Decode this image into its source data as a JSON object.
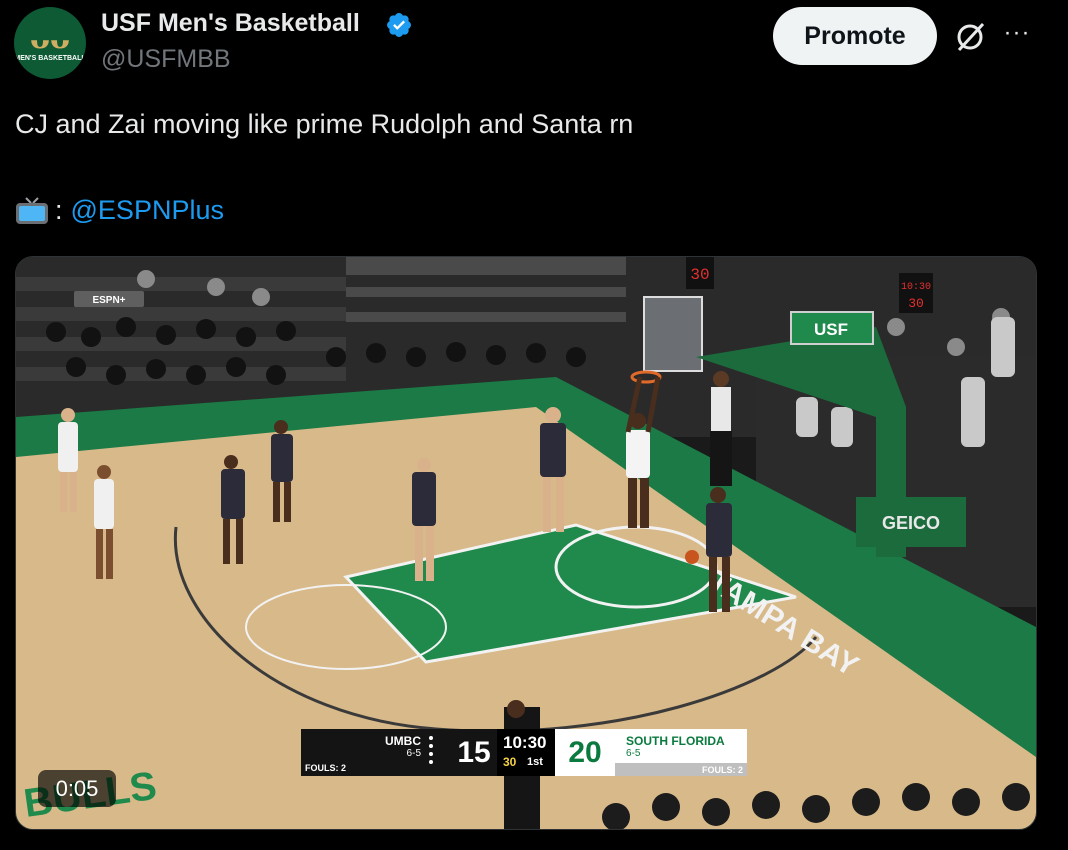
{
  "author": {
    "name": "USF Men's Basketball",
    "handle": "@USFMBB",
    "avatar_text": "MEN'S BASKETBALL",
    "verified_icon": "verified-badge-icon"
  },
  "actions": {
    "promote_label": "Promote",
    "grok_icon": "grok-icon",
    "more_label": "···"
  },
  "tweet": {
    "text": "CJ and Zai moving like prime Rudolph and Santa rn",
    "tv_icon": "television-icon",
    "colon": ":",
    "mention": "@ESPNPlus"
  },
  "video": {
    "elapsed": "0:05",
    "network_bug": "ESPN+",
    "courtside_banner": "USF",
    "sponsor": "GEICO",
    "court_text": "TAMPA BAY",
    "baseline_text": "BULLS",
    "game_clock_overhead": "10:30",
    "shot_clock_overhead": "30",
    "scoreboard": {
      "away_team": "UMBC",
      "away_record": "6-5",
      "away_fouls": "FOULS: 2",
      "away_score": "15",
      "clock": "10:30",
      "shot_clock": "30",
      "period": "1st",
      "home_score": "20",
      "home_team": "SOUTH FLORIDA",
      "home_record": "6-5",
      "home_fouls": "FOULS: 2"
    }
  }
}
